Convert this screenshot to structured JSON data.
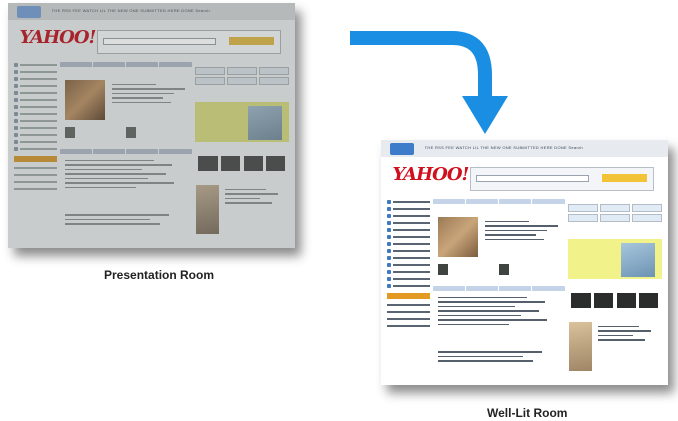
{
  "captions": {
    "left": "Presentation Room",
    "right": "Well-Lit Room"
  },
  "screenshot": {
    "logo_text": "YAHOO!",
    "topbar_text": "THE RSS FEE WATCH LIL THE NEW ONE SUBMITTED HERE DONE   Search"
  },
  "colors": {
    "arrow": "#1a8ee2",
    "presentation_tint": "#c9cccc",
    "welllit_tint": "#ffffff",
    "brand_red": "#d0111d"
  }
}
